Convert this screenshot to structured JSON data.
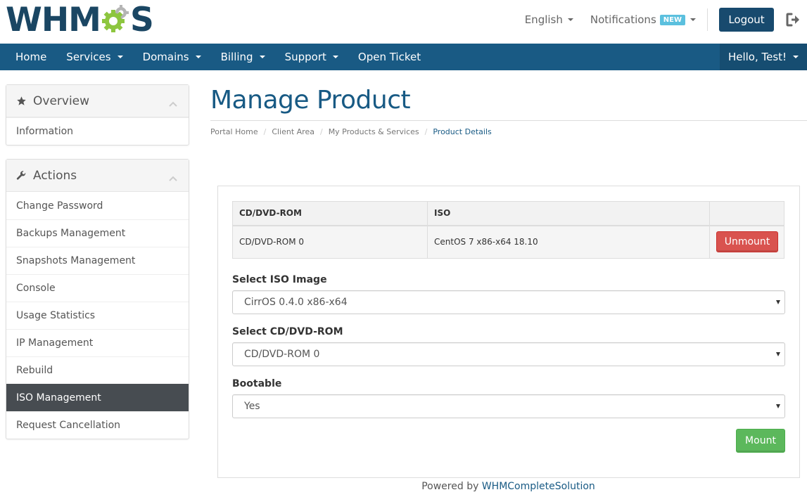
{
  "brand": {
    "logo_left": "WHM",
    "logo_right": "S",
    "colors": {
      "primary": "#1a4663",
      "gear": "#8dc63f",
      "gear2": "#b5b5b5"
    }
  },
  "topbar": {
    "language": "English",
    "notifications": "Notifications",
    "notifications_badge": "NEW",
    "logout": "Logout"
  },
  "nav": {
    "items": [
      {
        "label": "Home"
      },
      {
        "label": "Services"
      },
      {
        "label": "Domains"
      },
      {
        "label": "Billing"
      },
      {
        "label": "Support"
      },
      {
        "label": "Open Ticket"
      }
    ],
    "user": "Hello, Test!"
  },
  "sidebar": {
    "overview": {
      "title": "Overview",
      "items": [
        {
          "label": "Information"
        }
      ]
    },
    "actions": {
      "title": "Actions",
      "items": [
        {
          "label": "Change Password"
        },
        {
          "label": "Backups Management"
        },
        {
          "label": "Snapshots Management"
        },
        {
          "label": "Console"
        },
        {
          "label": "Usage Statistics"
        },
        {
          "label": "IP Management"
        },
        {
          "label": "Rebuild"
        },
        {
          "label": "ISO Management"
        },
        {
          "label": "Request Cancellation"
        }
      ]
    }
  },
  "main": {
    "title": "Manage Product",
    "breadcrumb": [
      "Portal Home",
      "Client Area",
      "My Products & Services",
      "Product Details"
    ],
    "table": {
      "headers": [
        "CD/DVD-ROM",
        "ISO",
        ""
      ],
      "rows": [
        {
          "drive": "CD/DVD-ROM 0",
          "iso": "CentOS 7 x86-x64 18.10",
          "action": "Unmount"
        }
      ]
    },
    "iso_label": "Select ISO Image",
    "iso_value": "CirrOS 0.4.0 x86-x64",
    "drive_label": "Select CD/DVD-ROM",
    "drive_value": "CD/DVD-ROM 0",
    "bootable_label": "Bootable",
    "bootable_value": "Yes",
    "mount": "Mount"
  },
  "footer": {
    "prefix": "Powered by",
    "link": "WHMCompleteSolution"
  }
}
